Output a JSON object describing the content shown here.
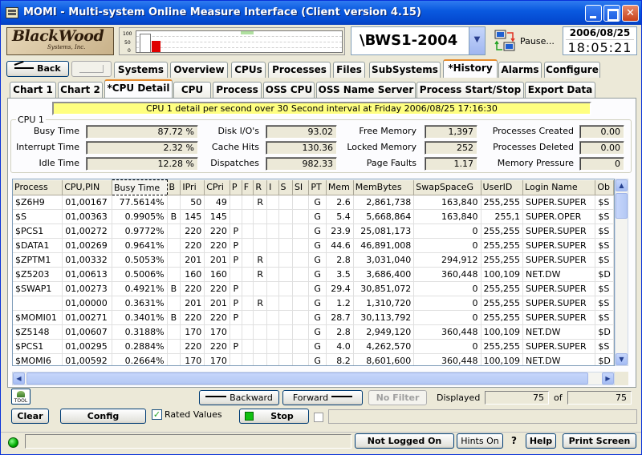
{
  "window": {
    "title": "MOMI - Multi-system Online Measure Interface (Client version 4.15)"
  },
  "logo": {
    "line1": "BlackWood",
    "line2": "Systems, Inc."
  },
  "gauge": {
    "ticks": [
      "100",
      "50",
      "0"
    ],
    "level": 0.55
  },
  "system": {
    "name": "\\BWS1-2004"
  },
  "pause": {
    "label": "Pause..."
  },
  "clock": {
    "date": "2006/08/25",
    "time": "18:05:21"
  },
  "nav": {
    "back": "Back"
  },
  "main_tabs": [
    "Systems",
    "Overview",
    "CPUs",
    "Processes",
    "Files",
    "SubSystems",
    "*History",
    "Alarms",
    "Configure"
  ],
  "sub_tabs": [
    "Chart 1",
    "Chart 2",
    "*CPU Detail",
    "CPU",
    "Process",
    "OSS CPU",
    "OSS Name Server",
    "Process Start/Stop",
    "Export Data"
  ],
  "banner": "CPU 1 detail per second over 30 Second interval at Friday 2006/08/25 17:16:30",
  "cpu_group": {
    "title": "CPU 1",
    "busy_time": {
      "label": "Busy Time",
      "value": "87.72 %"
    },
    "interrupt_time": {
      "label": "Interrupt Time",
      "value": "2.32 %"
    },
    "idle_time": {
      "label": "Idle Time",
      "value": "12.28 %"
    },
    "disk_ios": {
      "label": "Disk I/O's",
      "value": "93.02"
    },
    "cache_hits": {
      "label": "Cache Hits",
      "value": "130.36"
    },
    "dispatches": {
      "label": "Dispatches",
      "value": "982.33"
    },
    "free_memory": {
      "label": "Free Memory",
      "value": "1,397"
    },
    "locked_memory": {
      "label": "Locked Memory",
      "value": "252"
    },
    "page_faults": {
      "label": "Page Faults",
      "value": "1.17"
    },
    "processes_created": {
      "label": "Processes Created",
      "value": "0.00"
    },
    "processes_deleted": {
      "label": "Processes Deleted",
      "value": "0.00"
    },
    "memory_pressure": {
      "label": "Memory Pressure",
      "value": "0"
    }
  },
  "table": {
    "columns": [
      "Process",
      "CPU,PIN",
      "Busy Time",
      "B",
      "IPri",
      "CPri",
      "P",
      "F",
      "R",
      "I",
      "S",
      "SI",
      "PT",
      "Mem",
      "MemBytes",
      "SwapSpaceG",
      "UserID",
      "Login Name",
      "Ob"
    ],
    "rows": [
      [
        "$Z6H9",
        "01,00167",
        "77.5614%",
        "",
        "50",
        "49",
        "",
        "",
        "R",
        "",
        "",
        "",
        "G",
        "2.6",
        "2,861,738",
        "163,840",
        "255,255",
        "SUPER.SUPER",
        "$S"
      ],
      [
        "$S",
        "01,00363",
        "0.9905%",
        "B",
        "145",
        "145",
        "",
        "",
        "",
        "",
        "",
        "",
        "G",
        "5.4",
        "5,668,864",
        "163,840",
        "255,1",
        "SUPER.OPER",
        "$S"
      ],
      [
        "$PCS1",
        "01,00272",
        "0.9772%",
        "",
        "220",
        "220",
        "P",
        "",
        "",
        "",
        "",
        "",
        "G",
        "23.9",
        "25,081,173",
        "0",
        "255,255",
        "SUPER.SUPER",
        "$S"
      ],
      [
        "$DATA1",
        "01,00269",
        "0.9641%",
        "",
        "220",
        "220",
        "P",
        "",
        "",
        "",
        "",
        "",
        "G",
        "44.6",
        "46,891,008",
        "0",
        "255,255",
        "SUPER.SUPER",
        "$S"
      ],
      [
        "$ZPTM1",
        "01,00332",
        "0.5053%",
        "",
        "201",
        "201",
        "P",
        "",
        "R",
        "",
        "",
        "",
        "G",
        "2.8",
        "3,031,040",
        "294,912",
        "255,255",
        "SUPER.SUPER",
        "$S"
      ],
      [
        "$Z5203",
        "01,00613",
        "0.5006%",
        "",
        "160",
        "160",
        "",
        "",
        "R",
        "",
        "",
        "",
        "G",
        "3.5",
        "3,686,400",
        "360,448",
        "100,109",
        "NET.DW",
        "$D"
      ],
      [
        "$SWAP1",
        "01,00273",
        "0.4921%",
        "B",
        "220",
        "220",
        "P",
        "",
        "",
        "",
        "",
        "",
        "G",
        "29.4",
        "30,851,072",
        "0",
        "255,255",
        "SUPER.SUPER",
        "$S"
      ],
      [
        "",
        "01,00000",
        "0.3631%",
        "",
        "201",
        "201",
        "P",
        "",
        "R",
        "",
        "",
        "",
        "G",
        "1.2",
        "1,310,720",
        "0",
        "255,255",
        "SUPER.SUPER",
        "$S"
      ],
      [
        "$MOMI01",
        "01,00271",
        "0.3401%",
        "B",
        "220",
        "220",
        "P",
        "",
        "",
        "",
        "",
        "",
        "G",
        "28.7",
        "30,113,792",
        "0",
        "255,255",
        "SUPER.SUPER",
        "$S"
      ],
      [
        "$Z5148",
        "01,00607",
        "0.3188%",
        "",
        "170",
        "170",
        "",
        "",
        "",
        "",
        "",
        "",
        "G",
        "2.8",
        "2,949,120",
        "360,448",
        "100,109",
        "NET.DW",
        "$D"
      ],
      [
        "$PCS1",
        "01,00295",
        "0.2884%",
        "",
        "220",
        "220",
        "P",
        "",
        "",
        "",
        "",
        "",
        "G",
        "4.0",
        "4,262,570",
        "0",
        "255,255",
        "SUPER.SUPER",
        "$S"
      ],
      [
        "$MOMI6",
        "01,00592",
        "0.2664%",
        "",
        "170",
        "170",
        "",
        "",
        "",
        "",
        "",
        "",
        "G",
        "8.2",
        "8,601,600",
        "360,448",
        "100,109",
        "NET.DW",
        "$D"
      ]
    ]
  },
  "bottom": {
    "backward": "Backward",
    "forward": "Forward",
    "no_filter": "No Filter",
    "displayed_label": "Displayed",
    "displayed_value": "75",
    "of_label": "of",
    "total_value": "75",
    "tool_label": "TOOL",
    "clear": "Clear",
    "config": "Config",
    "rated_values": "Rated Values",
    "stop": "Stop"
  },
  "status": {
    "not_logged_on": "Not Logged On",
    "hints_on": "Hints On",
    "question": "?",
    "help": "Help",
    "print_screen": "Print Screen"
  }
}
